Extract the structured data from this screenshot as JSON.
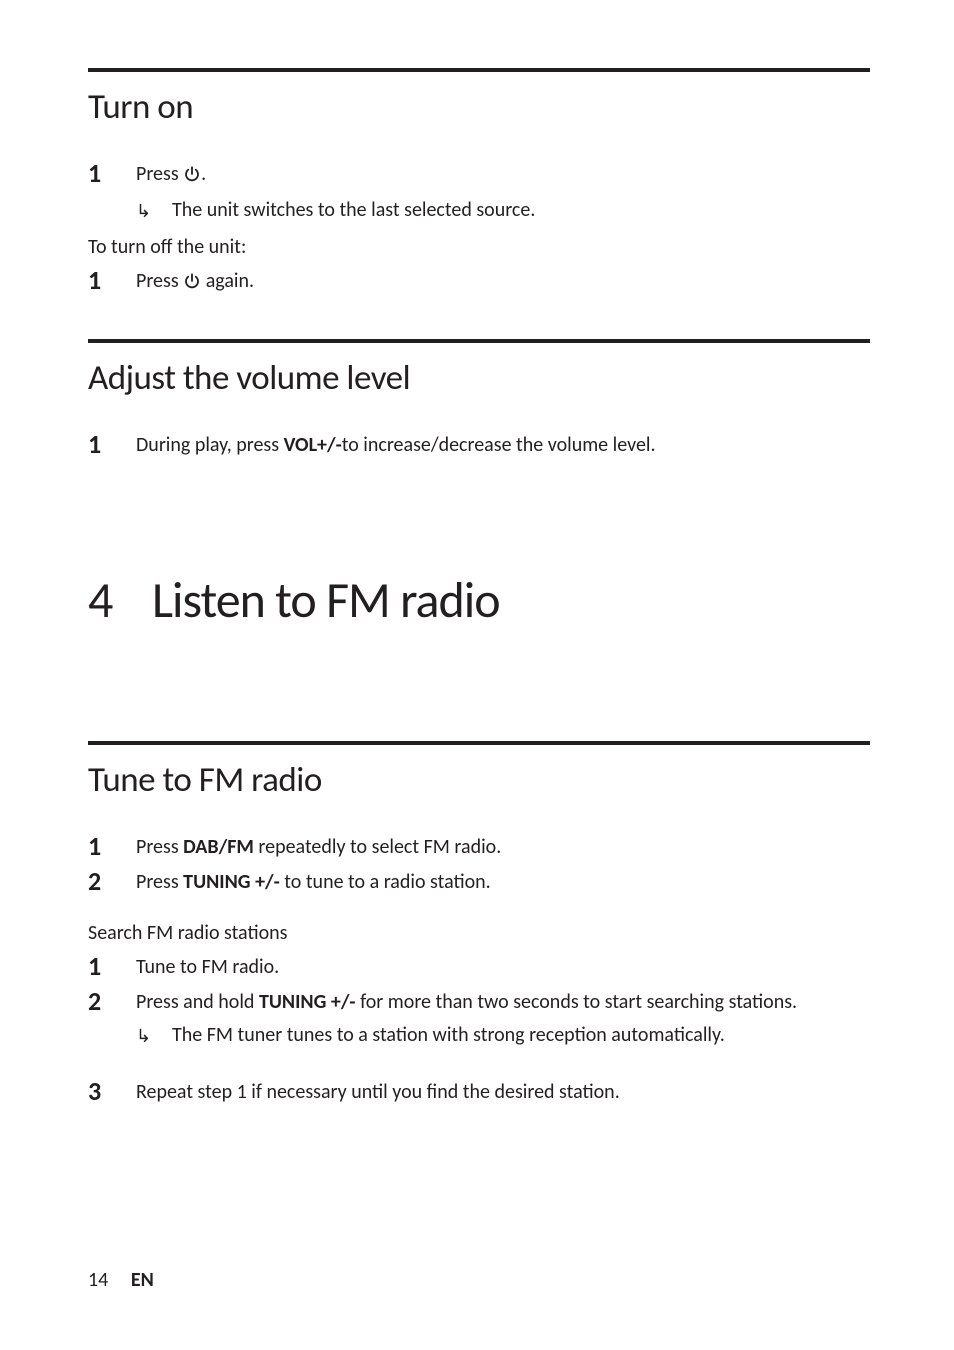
{
  "sections": {
    "turn_on": {
      "heading": "Turn on",
      "step1_a": "Press ",
      "step1_b": ".",
      "result1": "The unit switches to the last selected source.",
      "off_intro": "To turn off the unit:",
      "off_step1_a": "Press ",
      "off_step1_b": " again."
    },
    "volume": {
      "heading": "Adjust the volume level",
      "step1_a": "During play, press ",
      "step1_bold": "VOL+/-",
      "step1_b": "to increase/decrease the volume level."
    },
    "chapter": {
      "num": "4",
      "title": "Listen to FM radio"
    },
    "tune": {
      "heading": "Tune to FM radio",
      "step1_a": "Press ",
      "step1_bold": "DAB/FM",
      "step1_b": " repeatedly to select FM radio.",
      "step2_a": "Press ",
      "step2_bold": "TUNING +/-",
      "step2_b": " to tune to a radio station.",
      "search_heading": "Search FM radio stations",
      "s_step1": "Tune to FM radio.",
      "s_step2_a": "Press and hold ",
      "s_step2_bold": "TUNING +/-",
      "s_step2_b": " for more than two seconds to start searching stations.",
      "s_result2": "The FM tuner tunes to a station with strong reception automatically.",
      "s_step3": "Repeat step 1 if necessary until you find the desired station."
    }
  },
  "nums": {
    "one": "1",
    "two": "2",
    "three": "3"
  },
  "footer": {
    "page": "14",
    "lang": "EN"
  },
  "icons": {
    "power": "power-icon"
  }
}
